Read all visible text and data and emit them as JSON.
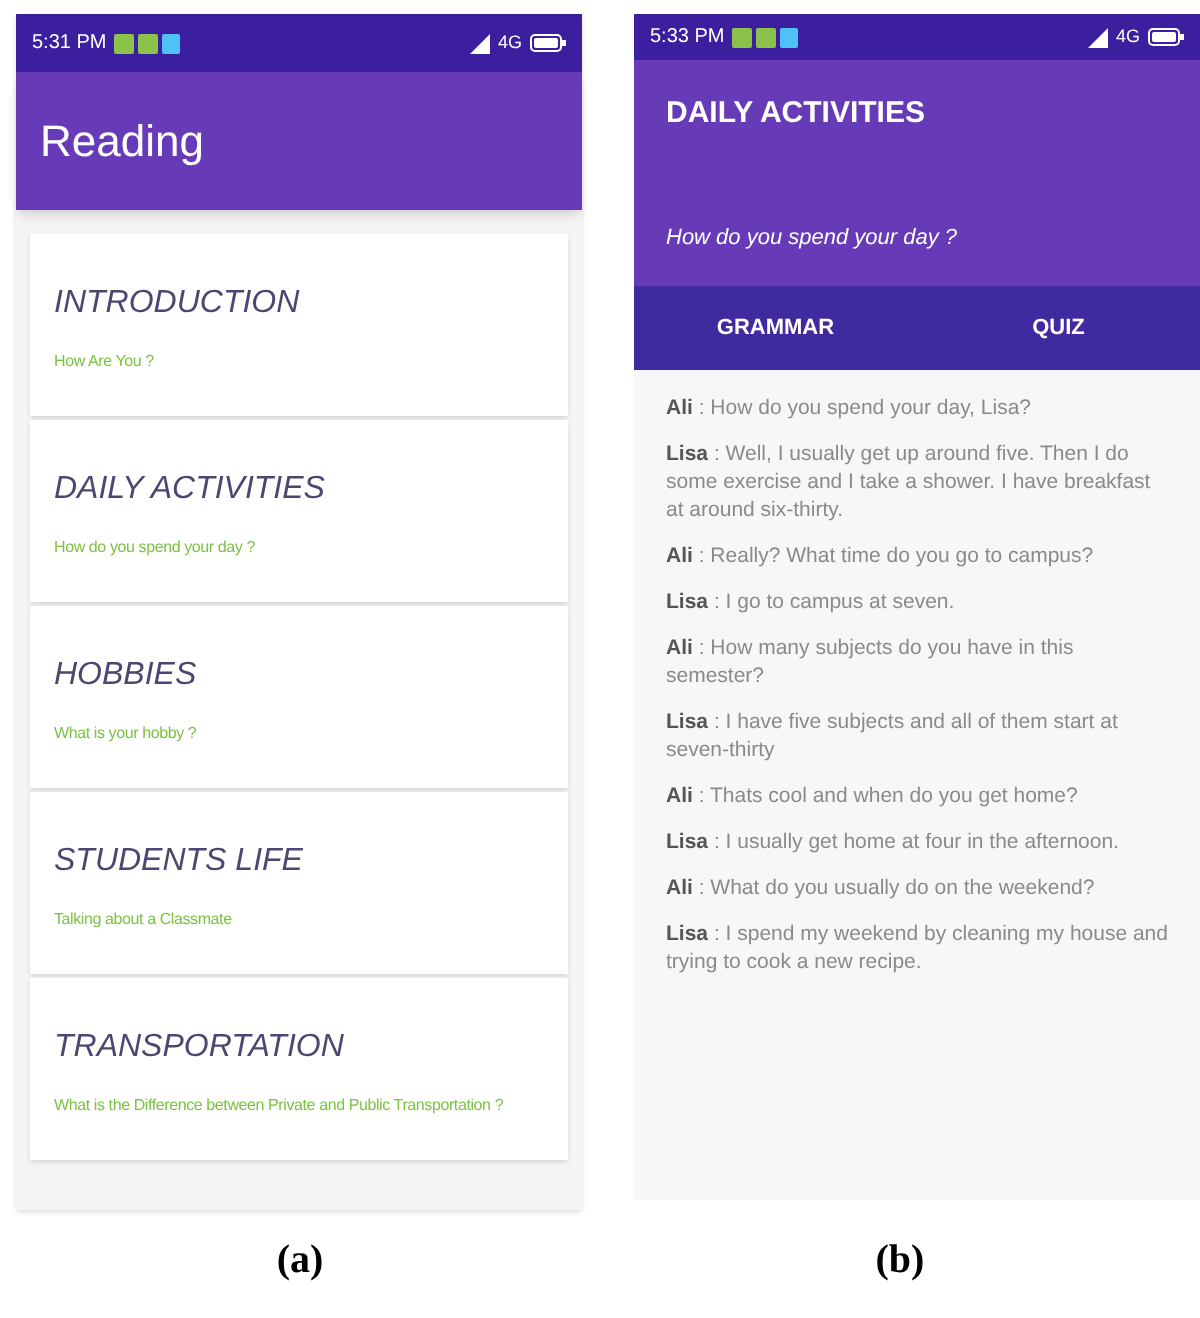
{
  "panels": [
    {
      "caption": "(a)",
      "status_bar": {
        "time": "5:31 PM",
        "network": "4G"
      },
      "app_bar": {
        "title": "Reading"
      },
      "lessons": [
        {
          "title": "INTRODUCTION",
          "subtitle": "How Are You ?"
        },
        {
          "title": "DAILY ACTIVITIES",
          "subtitle": "How do you spend your day ?"
        },
        {
          "title": "HOBBIES",
          "subtitle": "What is your hobby ?"
        },
        {
          "title": "STUDENTS LIFE",
          "subtitle": "Talking about a Classmate"
        },
        {
          "title": "TRANSPORTATION",
          "subtitle": "What is the Difference between Private and Public Transportation ?"
        }
      ]
    },
    {
      "caption": "(b)",
      "status_bar": {
        "time": "5:33 PM",
        "network": "4G"
      },
      "app_bar": {
        "title": "DAILY ACTIVITIES",
        "subtitle": "How do you spend your day ?"
      },
      "tabs": [
        {
          "label": "GRAMMAR"
        },
        {
          "label": "QUIZ"
        }
      ],
      "dialogue": [
        {
          "speaker": "Ali",
          "text": ": How do you spend your day, Lisa?"
        },
        {
          "speaker": "Lisa",
          "text": ": Well, I usually get up around five.  Then I do some exercise and I take a shower. I have breakfast at around six-thirty."
        },
        {
          "speaker": "Ali",
          "text": ": Really? What time do you go to campus?"
        },
        {
          "speaker": "Lisa",
          "text": ": I go to campus at seven."
        },
        {
          "speaker": "Ali",
          "text": ": How many subjects do you have in this semester?"
        },
        {
          "speaker": "Lisa",
          "text": ": I have five subjects and all of them start at seven-thirty"
        },
        {
          "speaker": "Ali",
          "text": ": Thats cool and when do you get home?"
        },
        {
          "speaker": "Lisa",
          "text": ": I usually get home at four in the afternoon."
        },
        {
          "speaker": "Ali",
          "text": ": What do you usually do on the weekend?"
        },
        {
          "speaker": "Lisa",
          "text": ": I spend my weekend by cleaning my house and trying to cook a new recipe."
        }
      ]
    }
  ]
}
